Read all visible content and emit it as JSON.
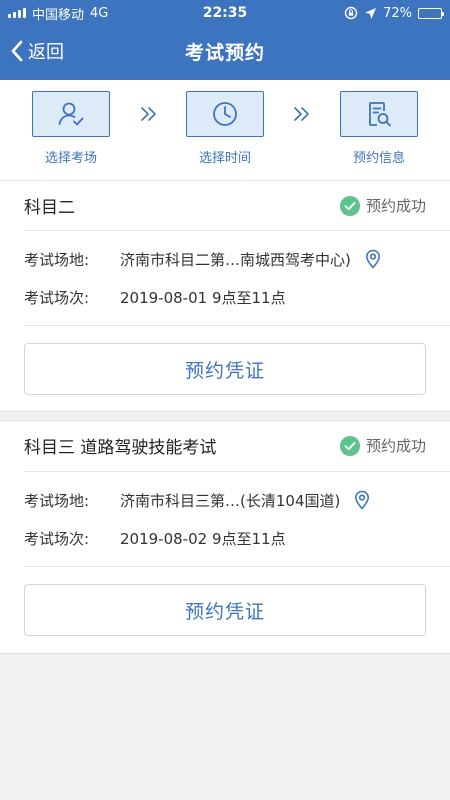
{
  "status_bar": {
    "carrier": "中国移动",
    "network": "4G",
    "time": "22:35",
    "battery_text": "72%",
    "battery_level": 0.72
  },
  "header": {
    "back_label": "返回",
    "title": "考试预约"
  },
  "steps": [
    {
      "label": "选择考场",
      "icon": "user-check-icon"
    },
    {
      "label": "选择时间",
      "icon": "clock-icon"
    },
    {
      "label": "预约信息",
      "icon": "document-search-icon"
    }
  ],
  "bookings": [
    {
      "subject": "科目二",
      "status": "预约成功",
      "venue_label": "考试场地:",
      "venue": "济南市科目二第…南城西驾考中心)",
      "session_label": "考试场次:",
      "session": "2019-08-01 9点至11点",
      "button_label": "预约凭证"
    },
    {
      "subject": "科目三 道路驾驶技能考试",
      "status": "预约成功",
      "venue_label": "考试场地:",
      "venue": "济南市科目三第…(长清104国道)",
      "session_label": "考试场次:",
      "session": "2019-08-02 9点至11点",
      "button_label": "预约凭证"
    }
  ],
  "colors": {
    "primary": "#3d74bf",
    "success": "#5cc38d",
    "background": "#f2f2f4"
  }
}
